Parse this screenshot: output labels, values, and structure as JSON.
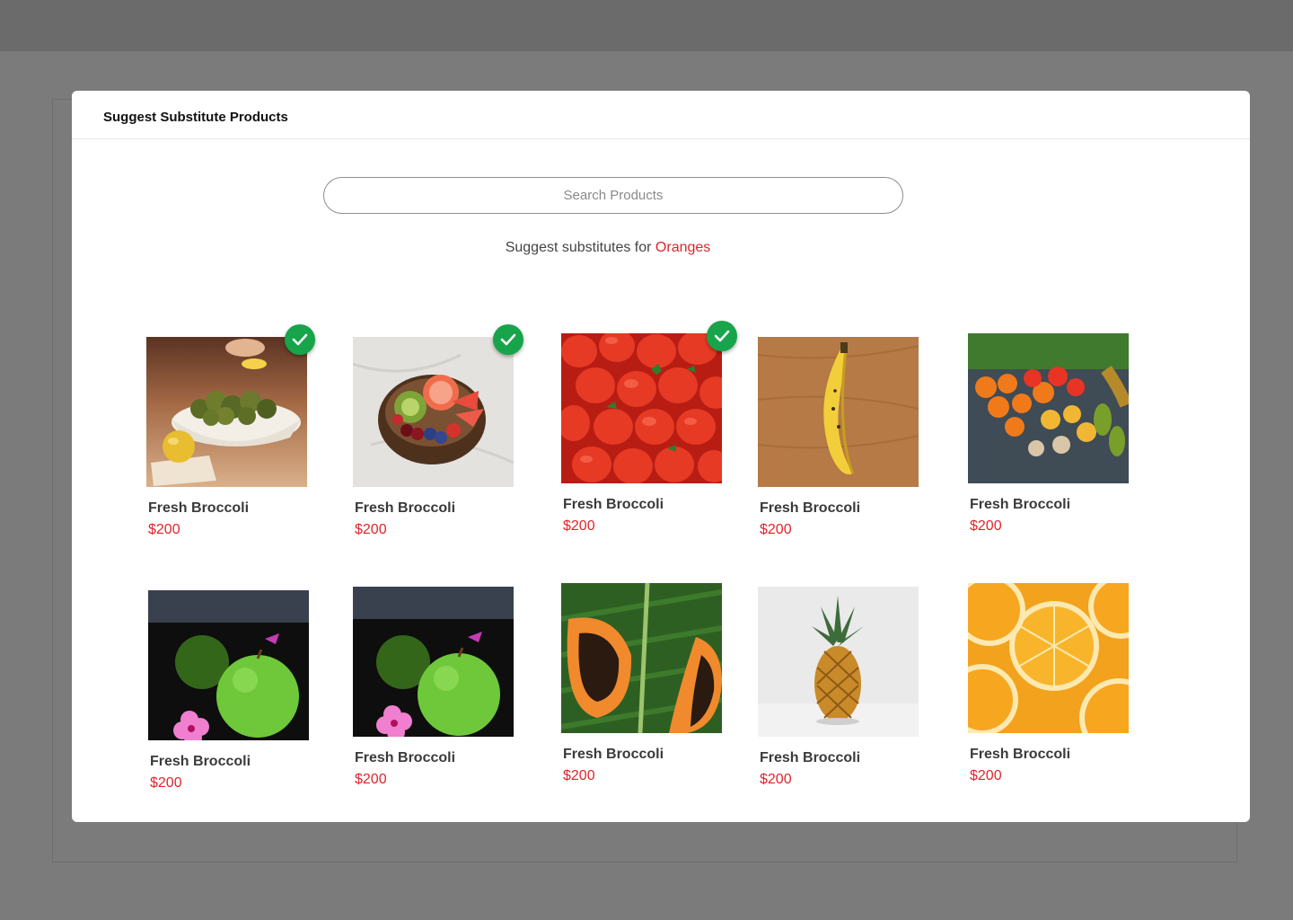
{
  "modal": {
    "title": "Suggest Substitute Products"
  },
  "search": {
    "placeholder": "Search Products"
  },
  "subtitle": {
    "prefix": "Suggest substitutes for",
    "product": "Oranges"
  },
  "products": [
    {
      "name": "Fresh Broccoli",
      "price": "$200",
      "selected": true,
      "image": "broccoli-bowl"
    },
    {
      "name": "Fresh Broccoli",
      "price": "$200",
      "selected": true,
      "image": "fruit-bowl"
    },
    {
      "name": "Fresh Broccoli",
      "price": "$200",
      "selected": true,
      "image": "strawberries"
    },
    {
      "name": "Fresh Broccoli",
      "price": "$200",
      "selected": false,
      "image": "banana"
    },
    {
      "name": "Fresh Broccoli",
      "price": "$200",
      "selected": false,
      "image": "mixed-produce"
    },
    {
      "name": "Fresh Broccoli",
      "price": "$200",
      "selected": false,
      "image": "green-apple"
    },
    {
      "name": "Fresh Broccoli",
      "price": "$200",
      "selected": false,
      "image": "green-apple"
    },
    {
      "name": "Fresh Broccoli",
      "price": "$200",
      "selected": false,
      "image": "papaya"
    },
    {
      "name": "Fresh Broccoli",
      "price": "$200",
      "selected": false,
      "image": "pineapple"
    },
    {
      "name": "Fresh Broccoli",
      "price": "$200",
      "selected": false,
      "image": "orange-slices"
    }
  ],
  "colors": {
    "accent": "#e0242b",
    "check": "#17a44a"
  }
}
